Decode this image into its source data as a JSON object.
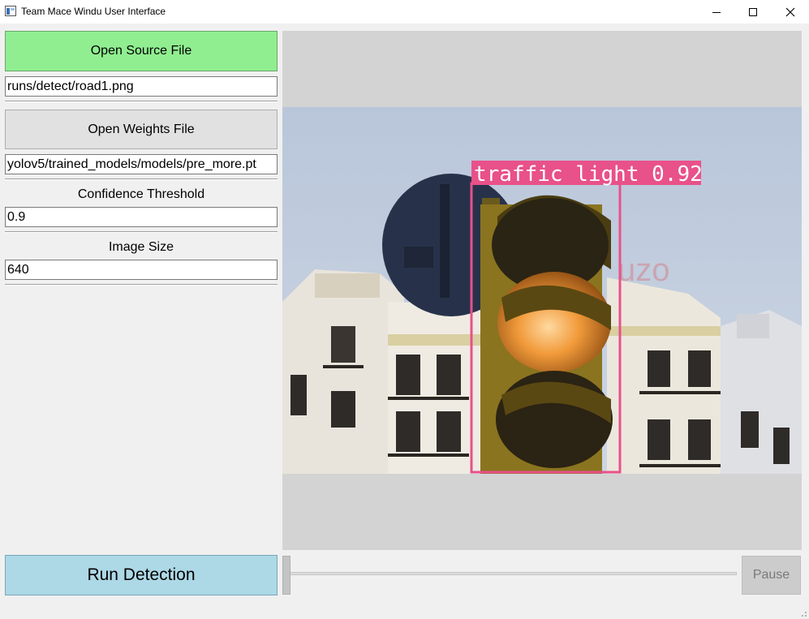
{
  "window": {
    "title": "Team Mace Windu User Interface",
    "controls": [
      "minimize",
      "maximize",
      "close"
    ]
  },
  "left_panel": {
    "open_source_button": "Open Source File",
    "source_path": "runs/detect/road1.png",
    "open_weights_button": "Open Weights File",
    "weights_path": "yolov5/trained_models/models/pre_more.pt",
    "confidence_label": "Confidence Threshold",
    "confidence_value": "0.9",
    "image_size_label": "Image Size",
    "image_size_value": "640",
    "run_button": "Run Detection"
  },
  "viewer": {
    "detection": {
      "label": "traffic light 0.92",
      "class": "traffic light",
      "confidence": 0.92
    },
    "building_sign_text": "uzo"
  },
  "playback": {
    "pause_button": "Pause",
    "slider_position": 0,
    "pause_enabled": false
  },
  "colors": {
    "source_button": "#90ee90",
    "run_button": "#add8e6",
    "detection_box": "#e8518a",
    "viewer_background": "#d3d3d3"
  }
}
